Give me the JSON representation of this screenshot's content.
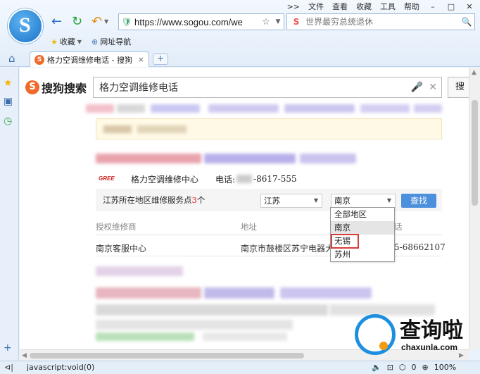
{
  "menu": {
    "more": ">>",
    "items": [
      "文件",
      "查看",
      "收藏",
      "工具",
      "帮助"
    ],
    "minimize": "–",
    "restore": "□",
    "close": "✕"
  },
  "nav": {
    "back": "←",
    "refresh": "↻",
    "undo": "↶"
  },
  "address": {
    "url": "https://www.sogou.com/we"
  },
  "browser_search": {
    "placeholder": "世界最穷总统退休"
  },
  "favbar": {
    "favorites": "收藏",
    "sites": "网址导航"
  },
  "tab": {
    "title": "格力空调维修电话 - 搜狗",
    "close": "×",
    "new": "+"
  },
  "sogou": {
    "logo_text": "搜狗搜索",
    "query": "格力空调维修电话",
    "search_btn": "搜"
  },
  "result": {
    "brand": "GREE",
    "center_name": "格力空调维修中心",
    "phone_label": "电话:",
    "phone_tail": "-8617-555",
    "filter_label_pre": "江苏所在地区维修服务点",
    "filter_count": "3",
    "filter_label_post": "个",
    "province": "江苏",
    "city": "南京",
    "find_btn": "查找",
    "col_dealer": "授权维修商",
    "col_address": "地址",
    "col_phone": "话",
    "row_dealer": "南京客服中心",
    "row_address": "南京市鼓楼区苏宁电器大",
    "row_phone": "5-68662107"
  },
  "dropdown": {
    "options": [
      "全部地区",
      "南京",
      "无锡",
      "苏州"
    ]
  },
  "status": {
    "text": "javascript:void(0)",
    "counter": "0",
    "zoom": "100%"
  },
  "watermark": {
    "name": "查询啦",
    "domain": "chaxunla.com"
  }
}
